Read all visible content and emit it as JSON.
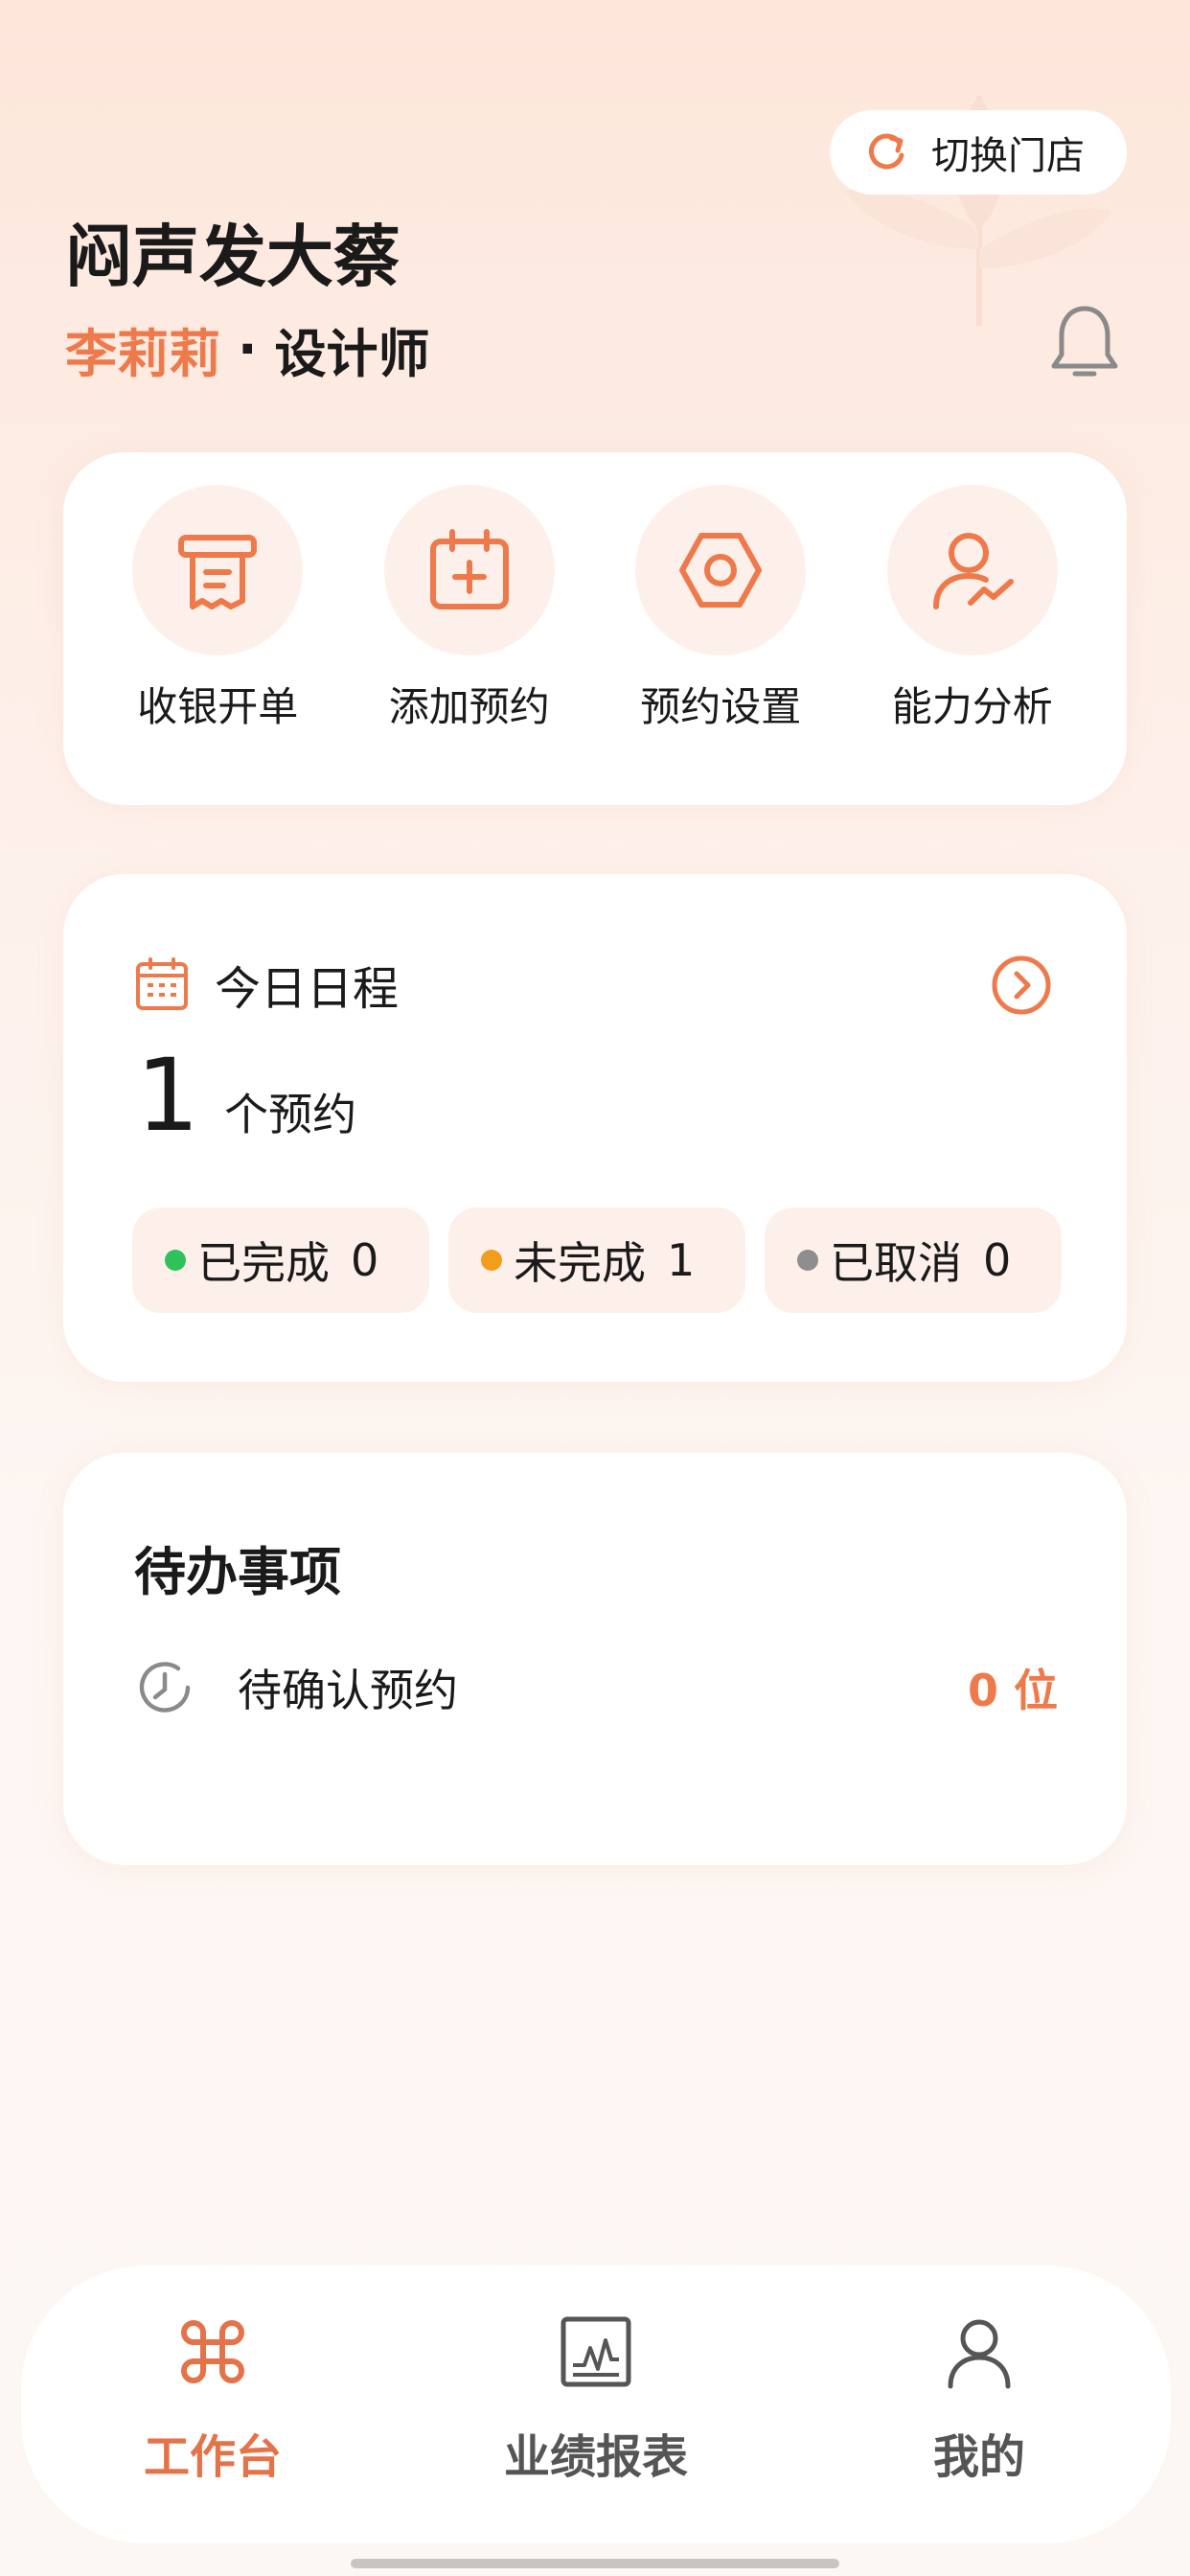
{
  "header": {
    "switch_store_label": "切换门店",
    "store_name": "闷声发大蔡",
    "user_name": "李莉莉",
    "separator": "·",
    "user_role": "设计师"
  },
  "quick_actions": [
    {
      "label": "收银开单",
      "icon": "receipt-icon"
    },
    {
      "label": "添加预约",
      "icon": "calendar-add-icon"
    },
    {
      "label": "预约设置",
      "icon": "settings-hexagon-icon"
    },
    {
      "label": "能力分析",
      "icon": "user-chart-icon"
    }
  ],
  "schedule": {
    "title": "今日日程",
    "count": "1",
    "count_unit": "个预约",
    "statuses": [
      {
        "label": "已完成",
        "value": "0",
        "color": "#2ec35a"
      },
      {
        "label": "未完成",
        "value": "1",
        "color": "#f29d1c"
      },
      {
        "label": "已取消",
        "value": "0",
        "color": "#8e8e8e"
      }
    ]
  },
  "todo": {
    "title": "待办事项",
    "item_label": "待确认预约",
    "item_value": "0 位"
  },
  "tabbar": {
    "tabs": [
      {
        "label": "工作台",
        "active": true
      },
      {
        "label": "业绩报表",
        "active": false
      },
      {
        "label": "我的",
        "active": false
      }
    ]
  },
  "colors": {
    "accent": "#ee7a4b",
    "accent_light": "#fdf0ea"
  }
}
